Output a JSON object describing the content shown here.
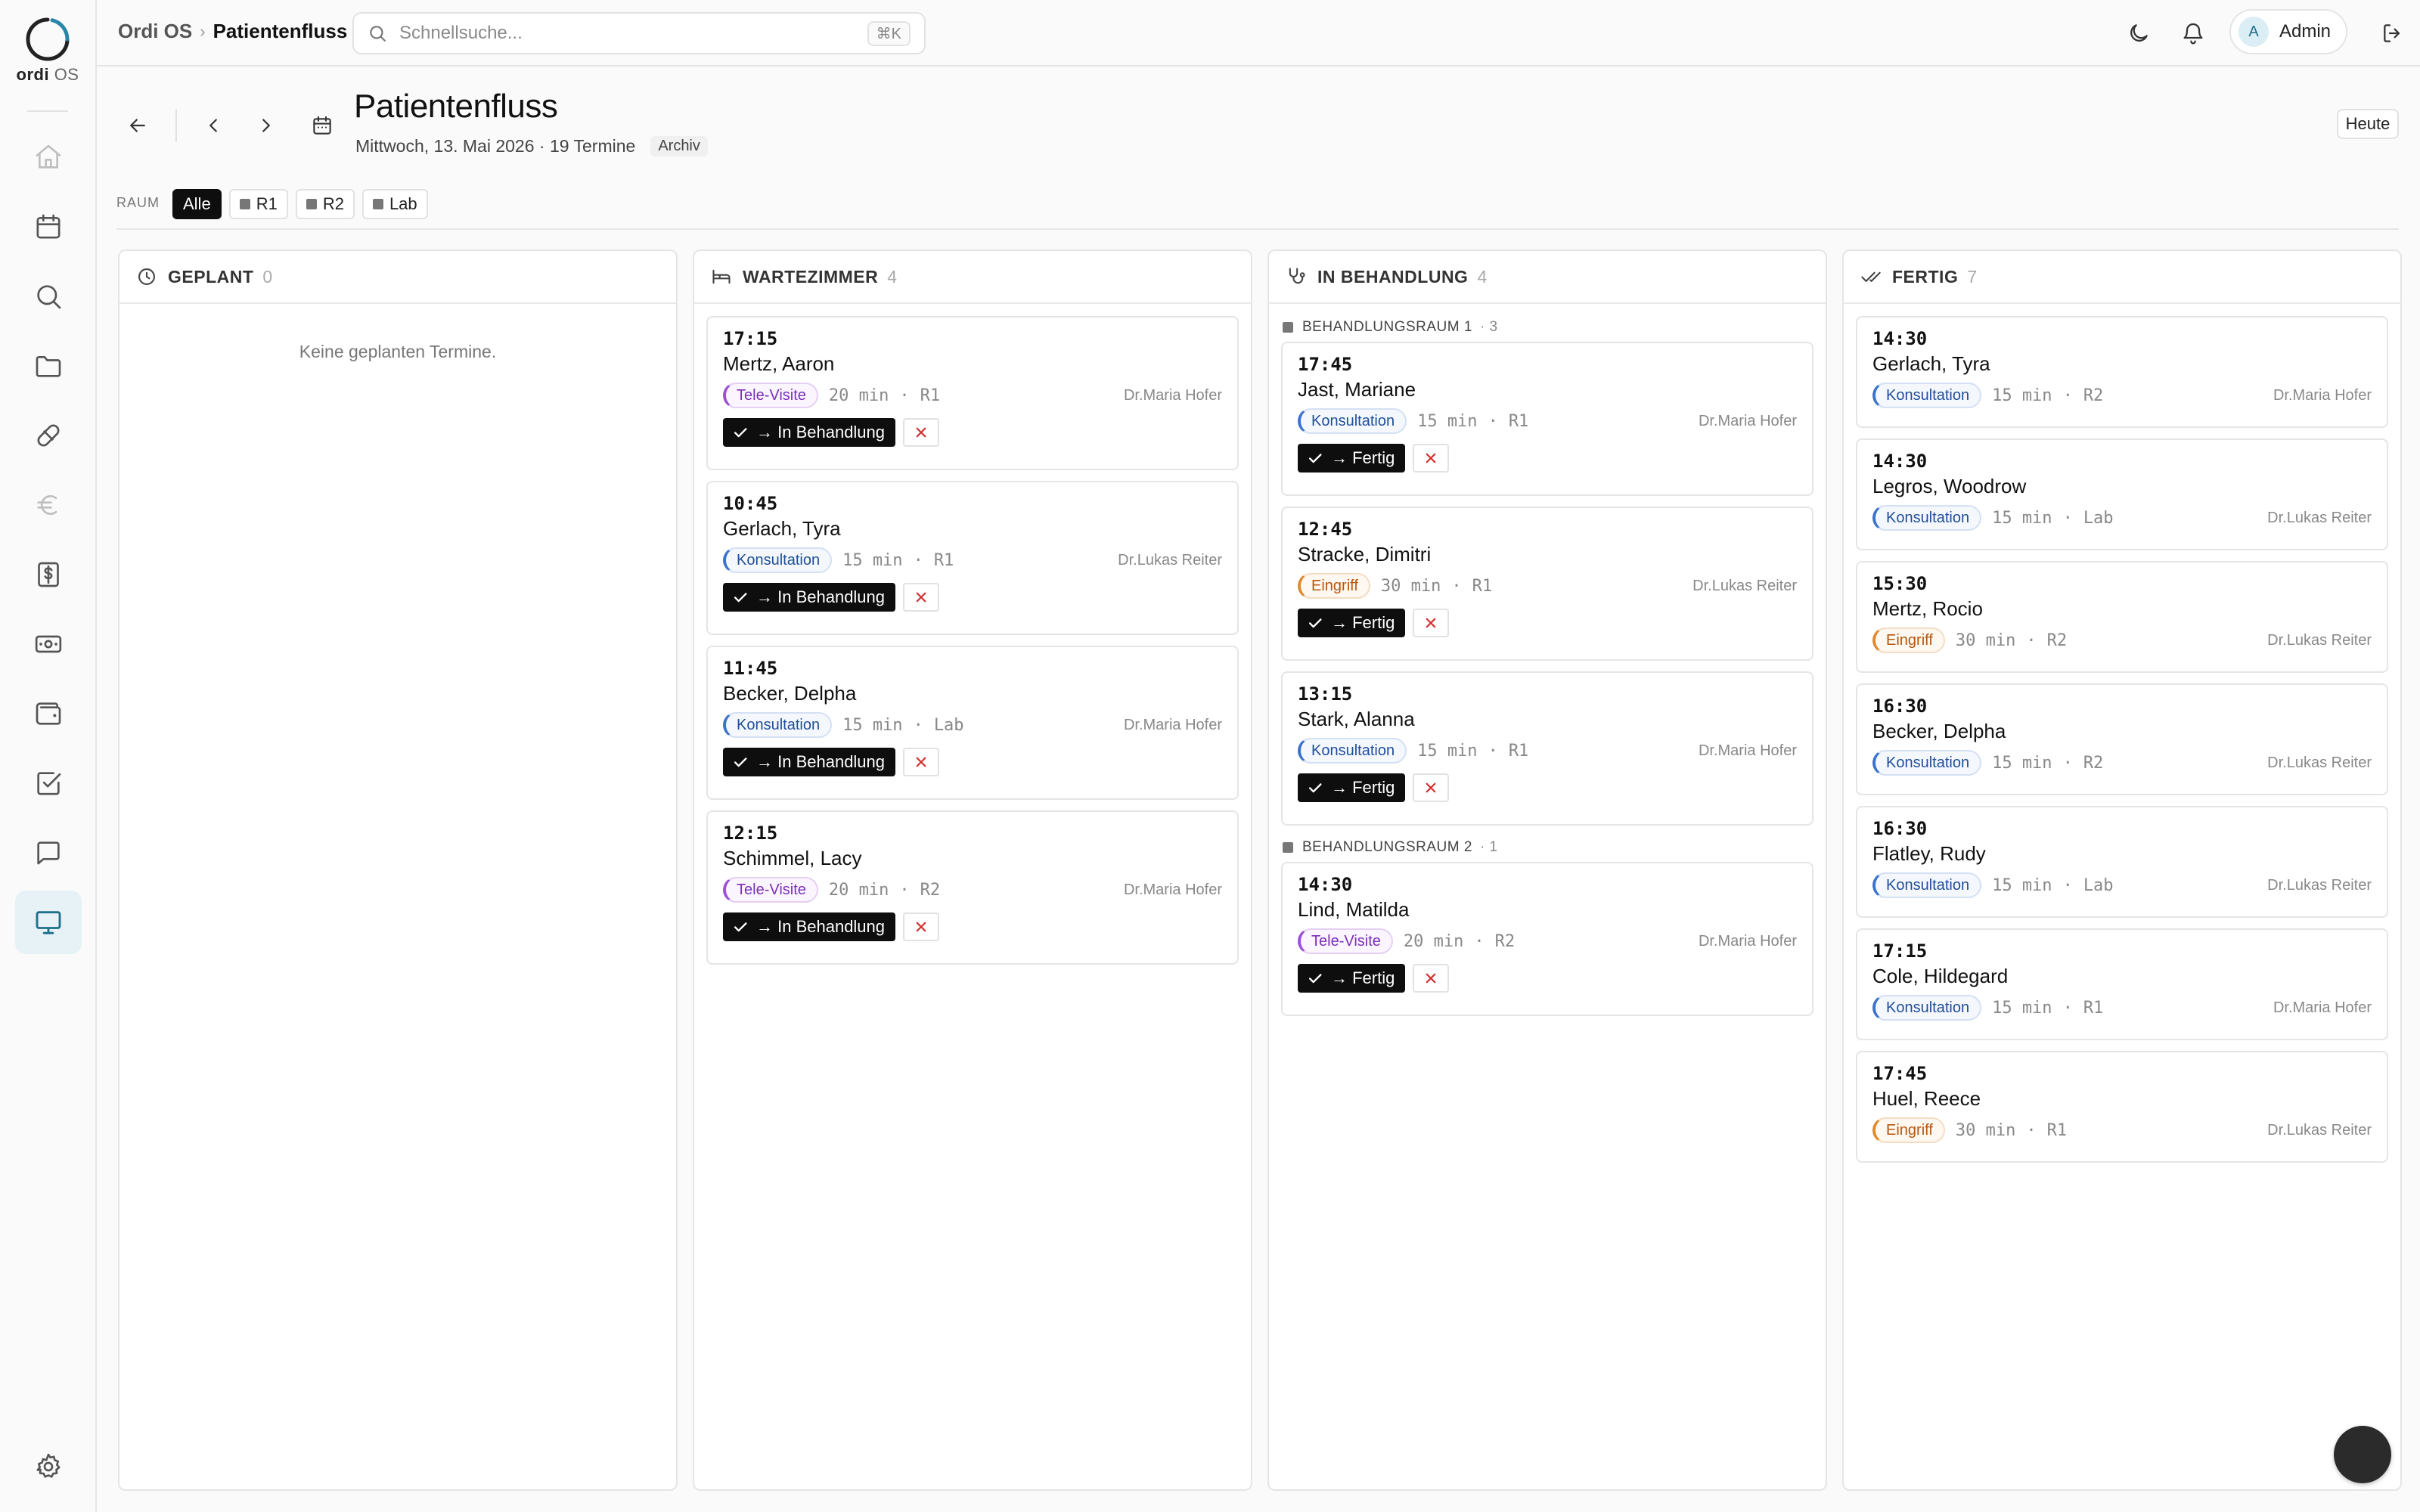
{
  "app": {
    "logo_text_bold": "ordi",
    "logo_text_light": "OS"
  },
  "header": {
    "breadcrumb_root": "Ordi OS",
    "breadcrumb_current": "Patientenfluss",
    "search_placeholder": "Schnellsuche...",
    "search_shortcut": "⌘K",
    "user_initial": "A",
    "user_name": "Admin"
  },
  "page": {
    "title": "Patientenfluss",
    "subtitle": "Mittwoch, 13. Mai 2026 · 19 Termine",
    "archive_badge": "Archiv",
    "today_button": "Heute"
  },
  "room_filter": {
    "label": "RAUM",
    "options": [
      {
        "label": "Alle",
        "active": true
      },
      {
        "label": "R1",
        "active": false
      },
      {
        "label": "R2",
        "active": false
      },
      {
        "label": "Lab",
        "active": false
      }
    ]
  },
  "columns": {
    "geplant": {
      "title": "GEPLANT",
      "count": "0",
      "empty_text": "Keine geplanten Termine."
    },
    "wartezimmer": {
      "title": "WARTEZIMMER",
      "count": "4",
      "action_label": "→ In Behandlung",
      "cards": [
        {
          "time": "17:15",
          "name": "Mertz, Aaron",
          "type": "Tele-Visite",
          "duration": "20 min",
          "room": "R1",
          "doctor": "Dr.Maria Hofer"
        },
        {
          "time": "10:45",
          "name": "Gerlach, Tyra",
          "type": "Konsultation",
          "duration": "15 min",
          "room": "R1",
          "doctor": "Dr.Lukas Reiter"
        },
        {
          "time": "11:45",
          "name": "Becker, Delpha",
          "type": "Konsultation",
          "duration": "15 min",
          "room": "Lab",
          "doctor": "Dr.Maria Hofer"
        },
        {
          "time": "12:15",
          "name": "Schimmel, Lacy",
          "type": "Tele-Visite",
          "duration": "20 min",
          "room": "R2",
          "doctor": "Dr.Maria Hofer"
        }
      ]
    },
    "in_behandlung": {
      "title": "IN BEHANDLUNG",
      "count": "4",
      "action_label": "→ Fertig",
      "groups": [
        {
          "title": "BEHANDLUNGSRAUM 1",
          "count": "· 3",
          "cards": [
            {
              "time": "17:45",
              "name": "Jast, Mariane",
              "type": "Konsultation",
              "duration": "15 min",
              "room": "R1",
              "doctor": "Dr.Maria Hofer"
            },
            {
              "time": "12:45",
              "name": "Stracke, Dimitri",
              "type": "Eingriff",
              "duration": "30 min",
              "room": "R1",
              "doctor": "Dr.Lukas Reiter"
            },
            {
              "time": "13:15",
              "name": "Stark, Alanna",
              "type": "Konsultation",
              "duration": "15 min",
              "room": "R1",
              "doctor": "Dr.Maria Hofer"
            }
          ]
        },
        {
          "title": "BEHANDLUNGSRAUM 2",
          "count": "· 1",
          "cards": [
            {
              "time": "14:30",
              "name": "Lind, Matilda",
              "type": "Tele-Visite",
              "duration": "20 min",
              "room": "R2",
              "doctor": "Dr.Maria Hofer"
            }
          ]
        }
      ]
    },
    "fertig": {
      "title": "FERTIG",
      "count": "7",
      "cards": [
        {
          "time": "14:30",
          "name": "Gerlach, Tyra",
          "type": "Konsultation",
          "duration": "15 min",
          "room": "R2",
          "doctor": "Dr.Maria Hofer"
        },
        {
          "time": "14:30",
          "name": "Legros, Woodrow",
          "type": "Konsultation",
          "duration": "15 min",
          "room": "Lab",
          "doctor": "Dr.Lukas Reiter"
        },
        {
          "time": "15:30",
          "name": "Mertz, Rocio",
          "type": "Eingriff",
          "duration": "30 min",
          "room": "R2",
          "doctor": "Dr.Lukas Reiter"
        },
        {
          "time": "16:30",
          "name": "Becker, Delpha",
          "type": "Konsultation",
          "duration": "15 min",
          "room": "R2",
          "doctor": "Dr.Lukas Reiter"
        },
        {
          "time": "16:30",
          "name": "Flatley, Rudy",
          "type": "Konsultation",
          "duration": "15 min",
          "room": "Lab",
          "doctor": "Dr.Lukas Reiter"
        },
        {
          "time": "17:15",
          "name": "Cole, Hildegard",
          "type": "Konsultation",
          "duration": "15 min",
          "room": "R1",
          "doctor": "Dr.Maria Hofer"
        },
        {
          "time": "17:45",
          "name": "Huel, Reece",
          "type": "Eingriff",
          "duration": "30 min",
          "room": "R1",
          "doctor": "Dr.Lukas Reiter"
        }
      ]
    }
  },
  "sidebar_icons": [
    "home-icon",
    "calendar-icon",
    "search-icon",
    "folder-icon",
    "pill-icon",
    "euro-icon",
    "dollar-file-icon",
    "banknote-icon",
    "wallet-icon",
    "checklist-icon",
    "chat-icon",
    "monitor-icon",
    "settings-icon"
  ],
  "colors": {
    "accent_active_bg": "#e6f2f6",
    "primary_button": "#0e0e0e",
    "tele_visite": "#9d4fd6",
    "konsultation": "#3b73cc",
    "eingriff": "#e08a2e"
  }
}
